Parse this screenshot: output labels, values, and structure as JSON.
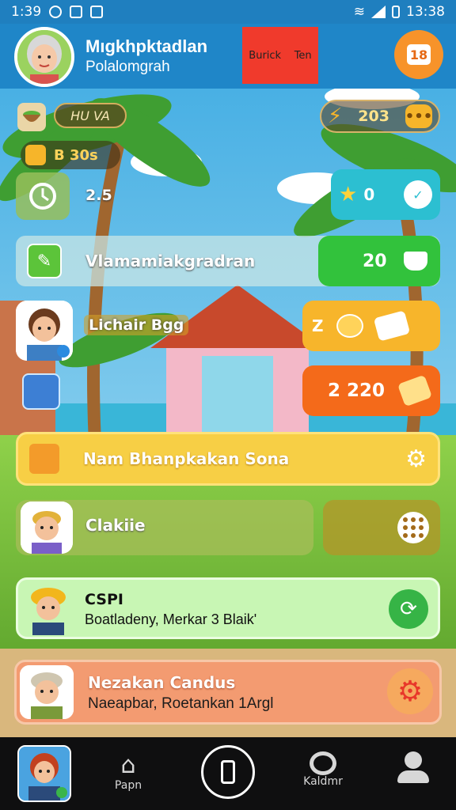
{
  "status_bar": {
    "left_time": "1:39",
    "right_time": "13:38"
  },
  "header": {
    "player_name": "Mıgkhpktadlan",
    "player_subtitle": "Polalomgrah",
    "banner_left": "Burick",
    "banner_right": "Ten",
    "notification_count": "18"
  },
  "hud": {
    "tag_label": "HU VA",
    "coins_value": "203",
    "coins_menu": "•••",
    "bag_value": "B 30s",
    "timer_value": "2.5",
    "stars_value": "0"
  },
  "rows": {
    "task_label": "Vlamamiakgradran",
    "task_value": "20",
    "player_name": "Lichair Bgg",
    "player_card_letter": "Z",
    "orange_value": "2 220",
    "banner_label": "Nam Bhanpkakan Sona",
    "olive_label": "Clakiie",
    "green_title": "CSPI",
    "green_sub": "Boatladeny, Merkar 3 Blaik'",
    "orange_title": "Nezakan Candus",
    "orange_sub": "Naeapbar, Roetankan 1Argl"
  },
  "bottom_nav": {
    "item1": "Papn",
    "item3": "Kaldmr"
  },
  "colors": {
    "header": "#1f86c8",
    "cyan_card": "#2cbfd1",
    "green_card": "#32c23c",
    "yellow_card": "#f7b52b",
    "orange_card": "#f46a1a",
    "banner": "#f7cf45",
    "green_row": "#c8f6b4",
    "orange_row": "#f39b71"
  }
}
